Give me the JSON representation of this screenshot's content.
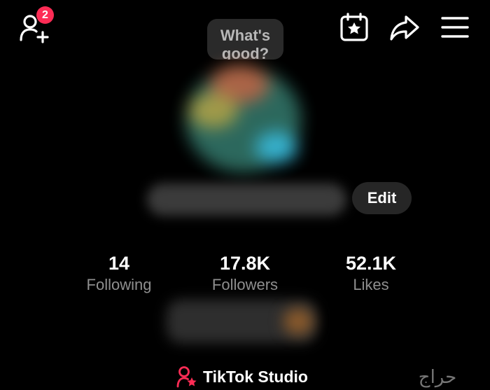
{
  "header": {
    "add_friend_badge": "2",
    "icons": [
      "add-friend-icon",
      "calendar-star-icon",
      "share-arrow-icon",
      "menu-icon"
    ]
  },
  "note": {
    "text": "What's good?"
  },
  "profile": {
    "edit_label": "Edit"
  },
  "stats": [
    {
      "value": "14",
      "label": "Following"
    },
    {
      "value": "17.8K",
      "label": "Followers"
    },
    {
      "value": "52.1K",
      "label": "Likes"
    }
  ],
  "studio": {
    "label": "TikTok Studio"
  },
  "watermark": {
    "text": "حراج"
  },
  "colors": {
    "background": "#000000",
    "badge": "#fe2c55",
    "accent": "#fe2c55",
    "muted_text": "#8f8f8f",
    "button_bg": "#262626"
  }
}
